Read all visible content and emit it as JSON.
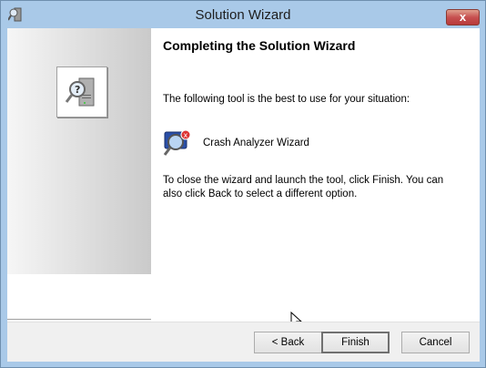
{
  "window": {
    "title": "Solution Wizard",
    "close_label": "x"
  },
  "page": {
    "heading": "Completing the Solution Wizard",
    "intro": "The following tool is the best to use for your situation:",
    "tool_name": "Crash Analyzer Wizard",
    "instructions": "To close the wizard and launch the tool, click Finish. You can also click Back to select a different option."
  },
  "buttons": {
    "back": "< Back",
    "finish": "Finish",
    "cancel": "Cancel"
  }
}
